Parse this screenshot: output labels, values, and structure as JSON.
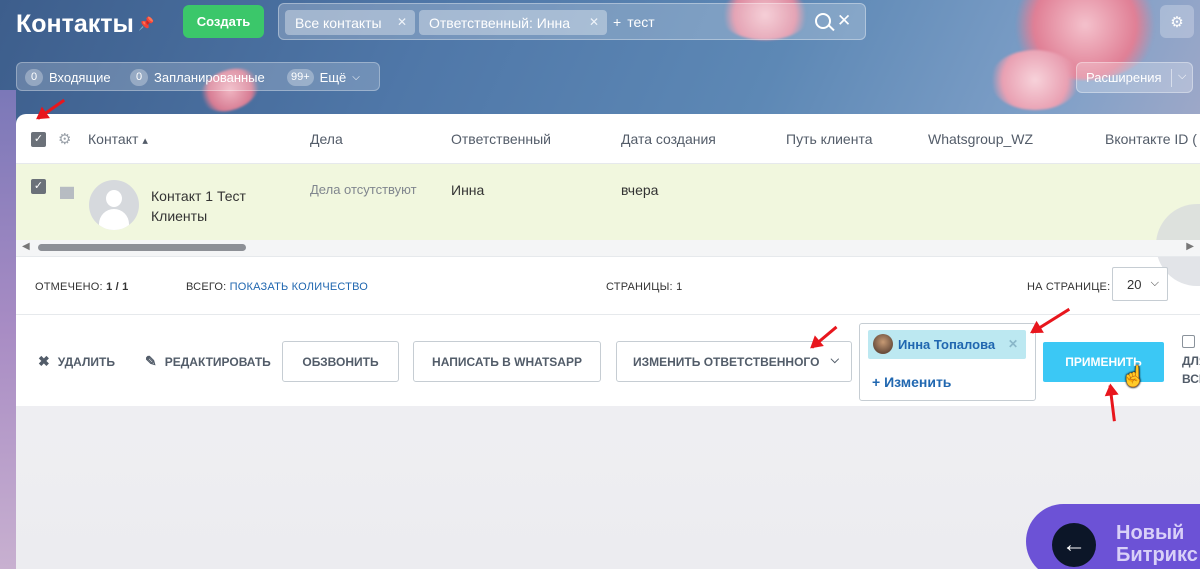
{
  "header": {
    "title": "Контакты",
    "create_label": "Создать",
    "filter_chips": [
      "Все контакты",
      "Ответственный: Инна"
    ],
    "search_text": "тест",
    "settings_icon": "gear-icon"
  },
  "counters": {
    "items": [
      {
        "count": "0",
        "label": "Входящие"
      },
      {
        "count": "0",
        "label": "Запланированные"
      }
    ],
    "more_count": "99+",
    "more_label": "Ещё"
  },
  "extensions_label": "Расширения",
  "grid": {
    "columns": [
      "Контакт",
      "Дела",
      "Ответственный",
      "Дата создания",
      "Путь клиента",
      "Whatsgroup_WZ",
      "Вконтакте ID ("
    ],
    "sort_indicator": "^",
    "rows": [
      {
        "name": "Контакт 1 Тест",
        "type": "Клиенты",
        "activities": "Дела отсутствуют",
        "responsible": "Инна",
        "created": "вчера"
      }
    ]
  },
  "footer": {
    "selected_label": "ОТМЕЧЕНО:",
    "selected_value": "1 / 1",
    "total_label": "ВСЕГО:",
    "total_link": "ПОКАЗАТЬ КОЛИЧЕСТВО",
    "pages_label": "СТРАНИЦЫ:",
    "pages_value": "1",
    "per_page_label": "НА СТРАНИЦЕ:",
    "per_page_value": "20"
  },
  "actions": {
    "delete": "УДАЛИТЬ",
    "edit": "РЕДАКТИРОВАТЬ",
    "call": "ОБЗВОНИТЬ",
    "whatsapp": "НАПИСАТЬ В WHATSAPP",
    "change_responsible": "ИЗМЕНИТЬ ОТВЕТСТВЕННОГО",
    "selected_person": "Инна Топалова",
    "change_link": "+ Изменить",
    "apply": "ПРИМЕНИТЬ",
    "for_all_line1": "ДЛЯ",
    "for_all_line2": "ВСЕ"
  },
  "promo": {
    "line1": "Новый",
    "line2": "Битрикс"
  },
  "colors": {
    "create_button": "#3bc76a",
    "apply_button": "#3bc8f5",
    "row_highlight": "#f1f7de",
    "link": "#2067b0",
    "annotation_arrow": "#e8161d",
    "promo": "#6c52d6"
  }
}
